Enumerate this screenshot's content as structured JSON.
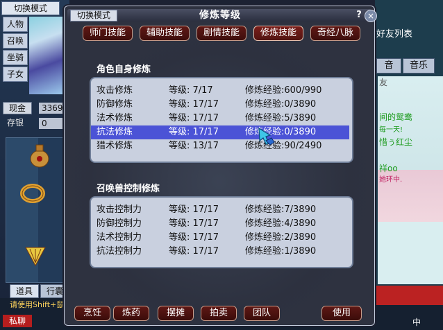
{
  "background": {
    "mode_button": "切换模式",
    "side_buttons": [
      "人物",
      "召唤",
      "坐骑",
      "子女"
    ],
    "cash_label": "现金",
    "cash_value": "3369",
    "deposit_label": "存银",
    "deposit_value": "0",
    "bottom_tabs": [
      "道具",
      "行囊"
    ],
    "hint": "请使用Shift+鼠",
    "private_chat": "私聊",
    "friend_list_title": "好友列表",
    "right_buttons": [
      "音",
      "音乐"
    ],
    "right_texts": [
      "友",
      "间的鸳鸯",
      "每一天!",
      "惜ぅ红尘",
      "祥oo",
      "她环中."
    ],
    "corner_text": "中"
  },
  "dialog": {
    "mode_button": "切换模式",
    "title": "修炼等级",
    "help": "?",
    "close": "×",
    "tabs": [
      "师门技能",
      "辅助技能",
      "剧情技能",
      "修炼技能",
      "奇经八脉"
    ],
    "active_tab": "修炼技能",
    "self_section_title": "角色自身修炼",
    "self_rows": [
      {
        "name": "攻击修炼",
        "level": "等级:  7/17",
        "exp": "修炼经验:600/990"
      },
      {
        "name": "防御修炼",
        "level": "等级: 17/17",
        "exp": "修炼经验:0/3890"
      },
      {
        "name": "法术修炼",
        "level": "等级: 17/17",
        "exp": "修炼经验:5/3890"
      },
      {
        "name": "抗法修炼",
        "level": "等级: 17/17",
        "exp": "修炼经验:0/3890"
      },
      {
        "name": "猎术修炼",
        "level": "等级: 13/17",
        "exp": "修炼经验:90/2490"
      }
    ],
    "selected_self_row": "抗法修炼",
    "pet_section_title": "召唤兽控制修炼",
    "pet_rows": [
      {
        "name": "攻击控制力",
        "level": "等级: 17/17",
        "exp": "修炼经验:7/3890"
      },
      {
        "name": "防御控制力",
        "level": "等级: 17/17",
        "exp": "修炼经验:4/3890"
      },
      {
        "name": "法术控制力",
        "level": "等级: 17/17",
        "exp": "修炼经验:2/3890"
      },
      {
        "name": "抗法控制力",
        "level": "等级: 17/17",
        "exp": "修炼经验:1/3890"
      }
    ],
    "bottom_buttons": [
      "烹饪",
      "炼药",
      "摆摊",
      "拍卖",
      "团队"
    ],
    "use_button": "使用"
  },
  "colors": {
    "tab_bg": "#5e1815",
    "panel_bg": "#c9d0df",
    "selected_row": "#4b53d6",
    "dialog_bg": "#2e3240"
  }
}
